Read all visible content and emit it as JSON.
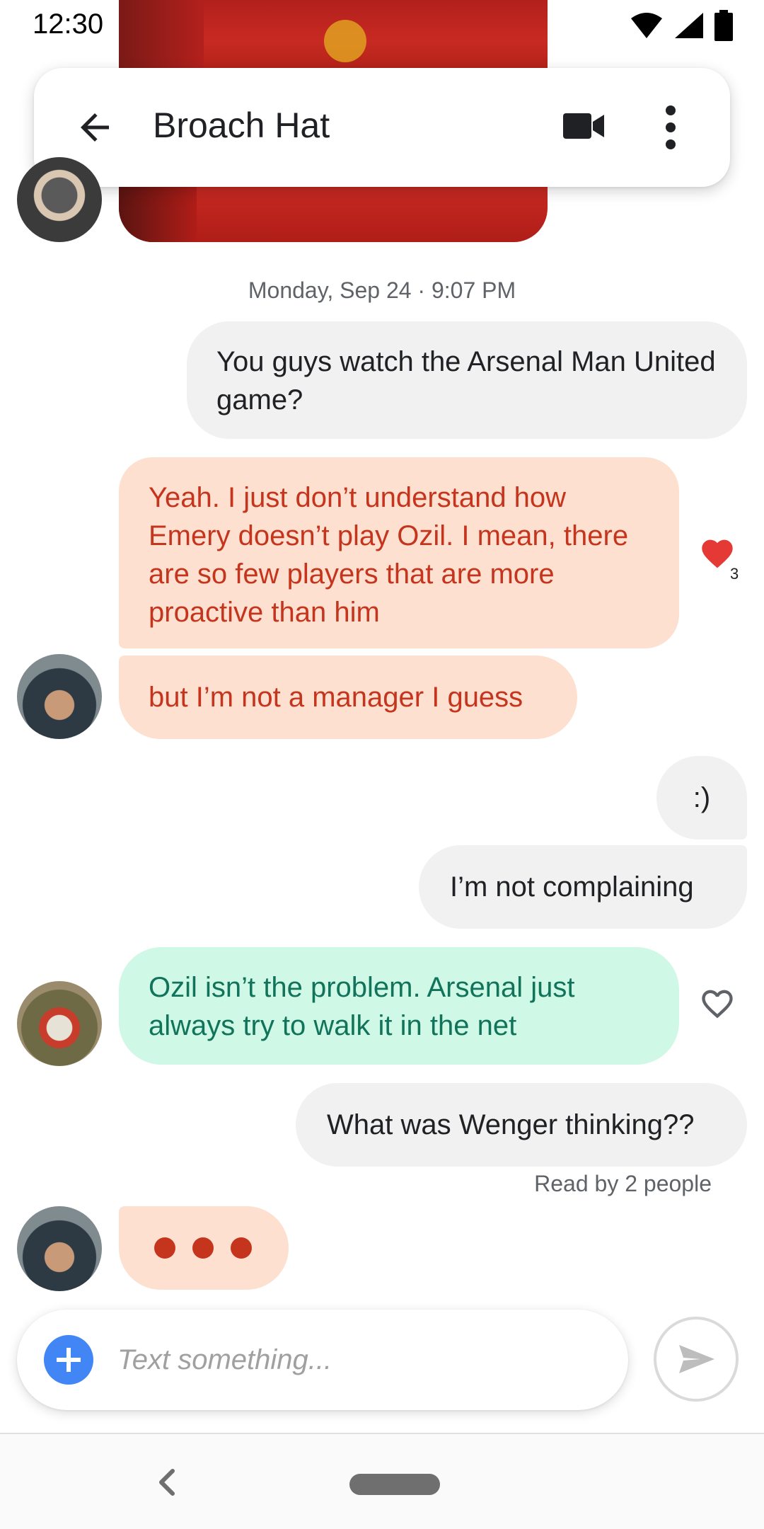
{
  "status_bar": {
    "time": "12:30",
    "icons": [
      "wifi-icon",
      "cell-signal-icon",
      "battery-icon"
    ]
  },
  "header": {
    "title": "Broach Hat",
    "back_icon": "arrow-back-icon",
    "video_icon": "video-camera-icon",
    "more_icon": "more-vert-icon"
  },
  "thread": {
    "timestamp": "Monday, Sep 24 · 9:07 PM",
    "messages": [
      {
        "direction": "outgoing",
        "text": "You guys watch the Arsenal Man United game?"
      },
      {
        "direction": "incoming",
        "text": "Yeah. I just don’t understand how Emery doesn’t play Ozil. I mean, there are so few players that are more proactive than him",
        "reaction": {
          "icon": "heart-filled-icon",
          "count": "3"
        }
      },
      {
        "direction": "incoming",
        "text": "but I’m not a manager I guess"
      },
      {
        "direction": "outgoing",
        "text": ":)"
      },
      {
        "direction": "outgoing",
        "text": "I’m not complaining"
      },
      {
        "direction": "incoming",
        "text": "Ozil isn’t the problem. Arsenal just always try to walk it in the net",
        "reaction": {
          "icon": "heart-outline-icon"
        }
      },
      {
        "direction": "outgoing",
        "text": "What was Wenger thinking??"
      }
    ],
    "read_receipt": "Read by 2 people",
    "typing_indicator": "typing-dots"
  },
  "composer": {
    "placeholder": "Text something...",
    "value": "",
    "add_icon": "plus-icon",
    "send_icon": "send-icon"
  },
  "colors": {
    "outgoing_bubble": "#f1f1f1",
    "incoming_orange_bubble": "#fde0d0",
    "incoming_orange_text": "#c5351d",
    "incoming_green_bubble": "#cff9e6",
    "incoming_green_text": "#11735a",
    "accent_blue": "#4285f4",
    "heart_red": "#e53935"
  },
  "nav_bar": {
    "back_icon": "nav-back-icon",
    "home_icon": "nav-home-pill"
  }
}
